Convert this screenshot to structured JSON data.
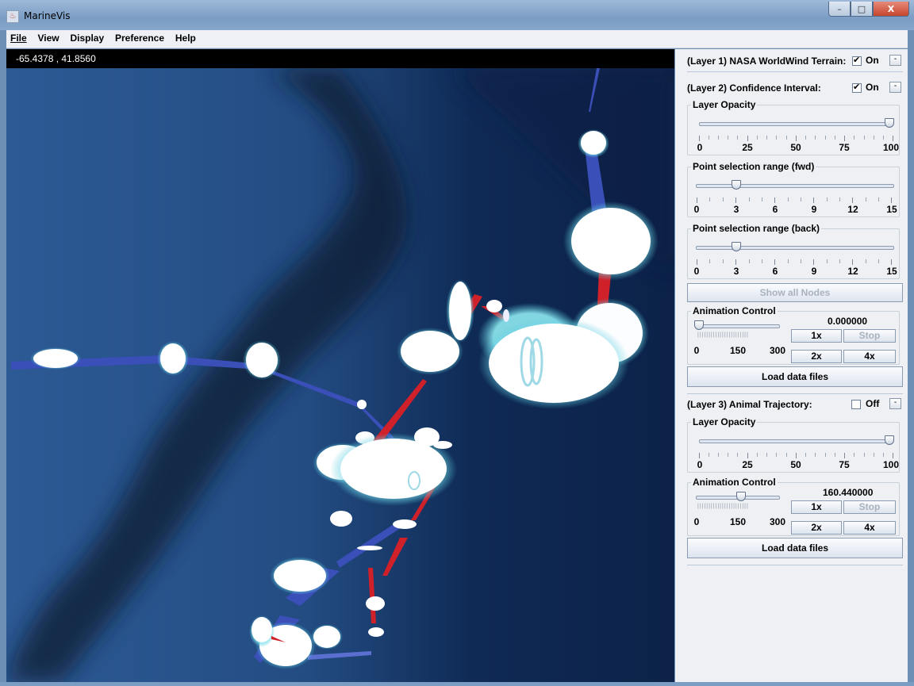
{
  "window": {
    "title": "MarineVis",
    "buttons": {
      "minimize": "–",
      "maximize": "□",
      "close": "X"
    }
  },
  "menu": [
    "File",
    "View",
    "Display",
    "Preference",
    "Help"
  ],
  "viewport": {
    "coordinates": "-65.4378 , 41.8560"
  },
  "panel": {
    "layer1": {
      "label": "(Layer 1) NASA WorldWind Terrain:",
      "toggle_label": "On",
      "checked": true,
      "collapse": "-"
    },
    "layer2": {
      "label": "(Layer 2) Confidence Interval:",
      "toggle_label": "On",
      "checked": true,
      "collapse": "-",
      "opacity": {
        "title": "Layer Opacity",
        "value": 100,
        "ticks": [
          "0",
          "25",
          "50",
          "75",
          "100"
        ]
      },
      "fwd": {
        "title": "Point selection range (fwd)",
        "value": 3,
        "ticks": [
          "0",
          "3",
          "6",
          "9",
          "12",
          "15"
        ]
      },
      "back": {
        "title": "Point selection range (back)",
        "value": 3,
        "ticks": [
          "0",
          "3",
          "6",
          "9",
          "12",
          "15"
        ]
      },
      "show_all": "Show all Nodes",
      "animation": {
        "title": "Animation Control",
        "value_text": "0.000000",
        "slider_value": 0,
        "ticks": [
          "0",
          "150",
          "300"
        ],
        "btn_1x": "1x",
        "btn_stop": "Stop",
        "btn_2x": "2x",
        "btn_4x": "4x"
      },
      "load": "Load data files"
    },
    "layer3": {
      "label": "(Layer 3) Animal Trajectory:",
      "toggle_label": "Off",
      "checked": false,
      "collapse": "-",
      "opacity": {
        "title": "Layer Opacity",
        "value": 100,
        "ticks": [
          "0",
          "25",
          "50",
          "75",
          "100"
        ]
      },
      "animation": {
        "title": "Animation Control",
        "value_text": "160.440000",
        "slider_value": 160.44,
        "ticks": [
          "0",
          "150",
          "300"
        ],
        "btn_1x": "1x",
        "btn_stop": "Stop",
        "btn_2x": "2x",
        "btn_4x": "4x"
      },
      "load": "Load data files"
    }
  },
  "colors": {
    "ocean": "#0f2c55",
    "trail_blue": "#3a4fb8",
    "trail_red": "#d0202a",
    "glow": "#7fe3ee"
  }
}
